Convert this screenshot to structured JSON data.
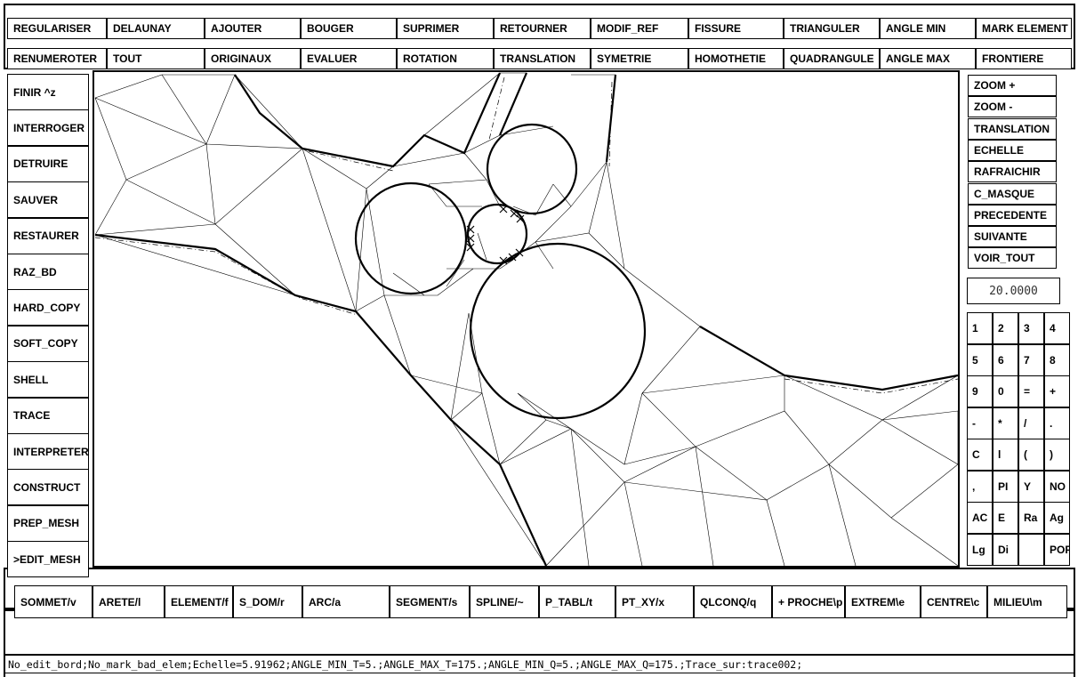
{
  "top_menu": {
    "row1": [
      "REGULARISER",
      "DELAUNAY",
      "AJOUTER",
      "BOUGER",
      "SUPRIMER",
      "RETOURNER",
      "MODIF_REF",
      "FISSURE",
      "TRIANGULER",
      "ANGLE MIN",
      "MARK ELEMENT"
    ],
    "row2": [
      "RENUMEROTER",
      "TOUT",
      "ORIGINAUX",
      "EVALUER",
      "ROTATION",
      "TRANSLATION",
      "SYMETRIE",
      "HOMOTHETIE",
      "QUADRANGULE",
      "ANGLE MAX",
      "FRONTIERE"
    ]
  },
  "left_menu": [
    "FINIR ^z",
    "INTERROGER",
    "DETRUIRE",
    "SAUVER",
    "RESTAURER",
    "RAZ_BD",
    "HARD_COPY",
    "SOFT_COPY",
    "SHELL",
    "TRACE",
    "INTERPRETER",
    "CONSTRUCT",
    "PREP_MESH",
    ">EDIT_MESH"
  ],
  "right_menu": [
    "ZOOM +",
    "ZOOM -",
    "TRANSLATION",
    "ECHELLE",
    "RAFRAICHIR",
    "C_MASQUE",
    "PRECEDENTE",
    "SUIVANTE",
    "VOIR_TOUT"
  ],
  "value_display": "20.0000",
  "keypad": [
    [
      "1",
      "2",
      "3",
      "4"
    ],
    [
      "5",
      "6",
      "7",
      "8"
    ],
    [
      "9",
      "0",
      "=",
      "+"
    ],
    [
      "-",
      "*",
      "/",
      "."
    ],
    [
      "C",
      "l",
      "(",
      ")"
    ],
    [
      ",",
      "PI",
      "Y",
      "NO"
    ],
    [
      "AC",
      "E",
      "Ra",
      "Ag"
    ],
    [
      "Lg",
      "Di",
      "",
      "POP"
    ]
  ],
  "bottom_menu": [
    "SOMMET/v",
    "ARETE/l",
    "ELEMENT/f",
    "S_DOM/r",
    "ARC/a",
    "SEGMENT/s",
    "SPLINE/~",
    "P_TABL/t",
    "PT_XY/x",
    "QLCONQ/q",
    "+ PROCHE\\p",
    "EXTREM\\e",
    "CENTRE\\c",
    "MILIEU\\m"
  ],
  "status_line": "No_edit_bord;No_mark_bad_elem;Echelle=5.91962;ANGLE_MIN_T=5.;ANGLE_MAX_T=175.;ANGLE_MIN_Q=5.;ANGLE_MAX_Q=175.;Trace_sur:trace002;"
}
